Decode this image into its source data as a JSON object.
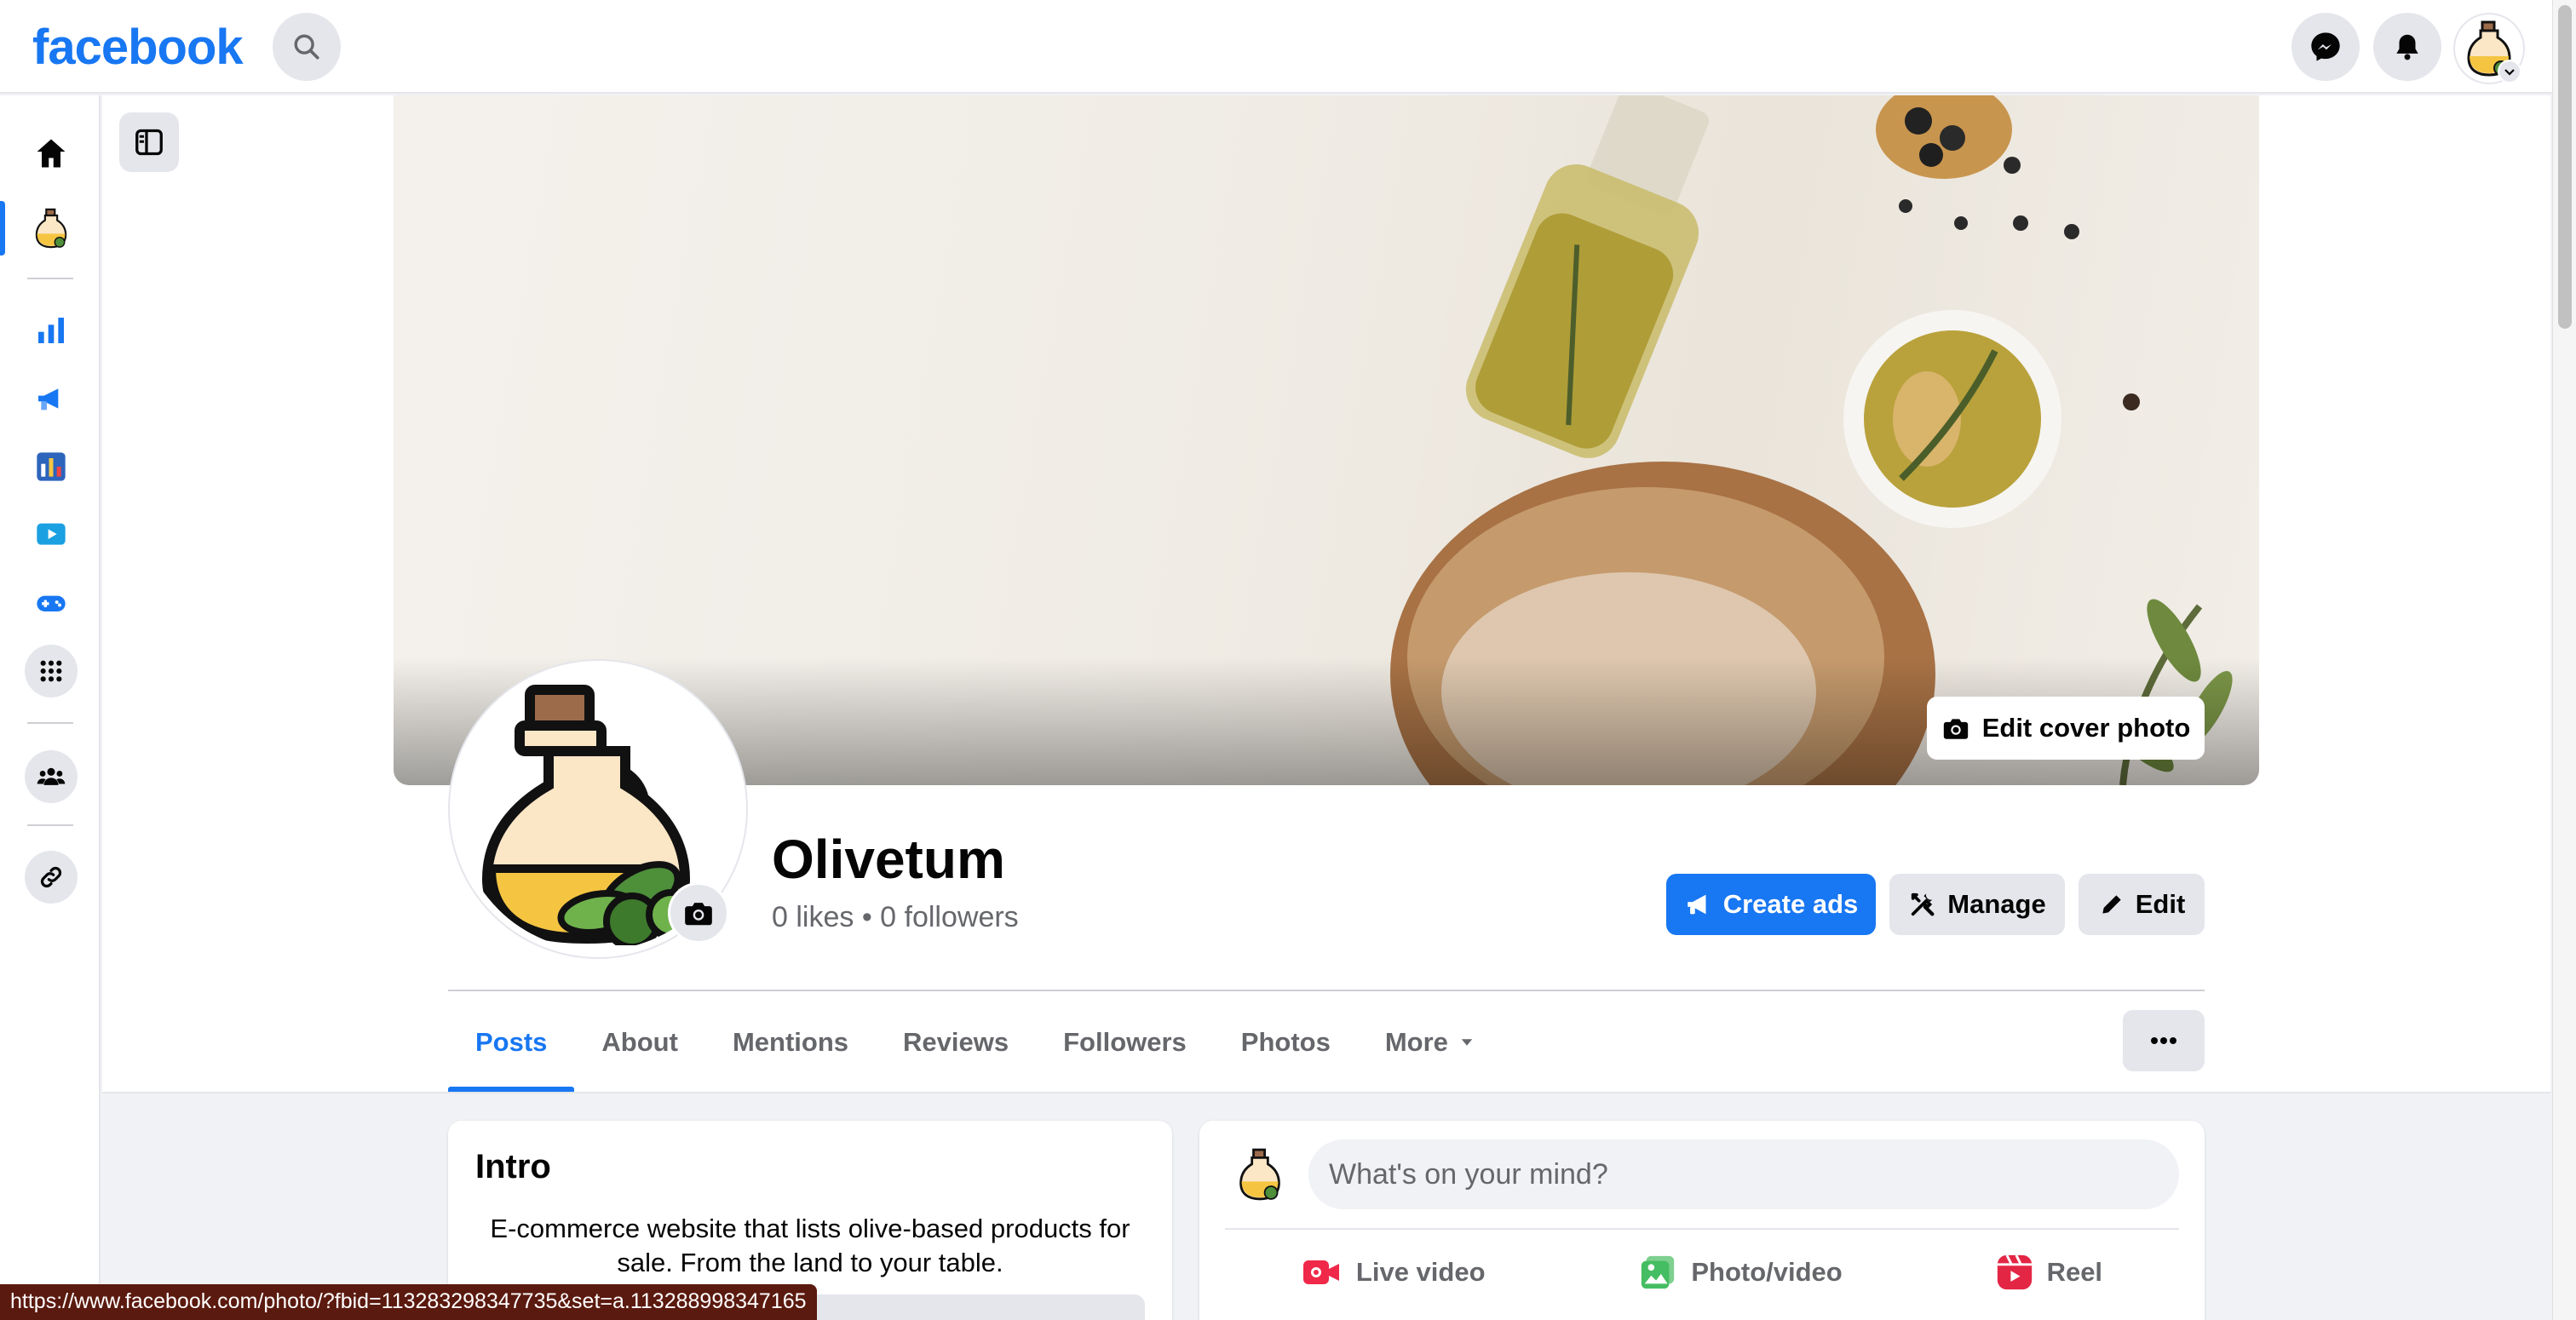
{
  "header": {
    "logo": "facebook",
    "search_icon": "search-icon",
    "messenger_icon": "messenger-icon",
    "notifications_icon": "bell-icon",
    "account_icon": "olive-oil-avatar"
  },
  "rail": {
    "items": [
      {
        "name": "home",
        "icon": "home-icon"
      },
      {
        "name": "page",
        "icon": "olive-oil-avatar"
      },
      {
        "name": "insights",
        "icon": "bar-chart-icon"
      },
      {
        "name": "ads",
        "icon": "megaphone-icon"
      },
      {
        "name": "dashboard",
        "icon": "dashboard-icon"
      },
      {
        "name": "video",
        "icon": "video-icon"
      },
      {
        "name": "gaming",
        "icon": "gamepad-icon"
      },
      {
        "name": "apps",
        "icon": "grid-icon"
      },
      {
        "name": "groups",
        "icon": "groups-icon"
      },
      {
        "name": "links",
        "icon": "link-icon"
      }
    ]
  },
  "cover": {
    "edit_cover_label": "Edit cover photo"
  },
  "profile": {
    "name": "Olivetum",
    "stats": "0 likes • 0 followers"
  },
  "actions": {
    "create_ads": "Create ads",
    "manage": "Manage",
    "edit": "Edit"
  },
  "tabs": [
    {
      "label": "Posts",
      "active": true
    },
    {
      "label": "About"
    },
    {
      "label": "Mentions"
    },
    {
      "label": "Reviews"
    },
    {
      "label": "Followers"
    },
    {
      "label": "Photos"
    },
    {
      "label": "More"
    }
  ],
  "intro": {
    "title": "Intro",
    "bio": "E-commerce website that lists olive-based products for sale. From the land to your table."
  },
  "composer": {
    "placeholder": "What's on your mind?",
    "actions": [
      {
        "label": "Live video",
        "color": "#f02849"
      },
      {
        "label": "Photo/video",
        "color": "#45bd62"
      },
      {
        "label": "Reel",
        "color": "#e42645"
      }
    ]
  },
  "status_url": "https://www.facebook.com/photo/?fbid=113283298347735&set=a.113288998347165",
  "colors": {
    "brand": "#1877f2",
    "background": "#f0f2f5"
  }
}
